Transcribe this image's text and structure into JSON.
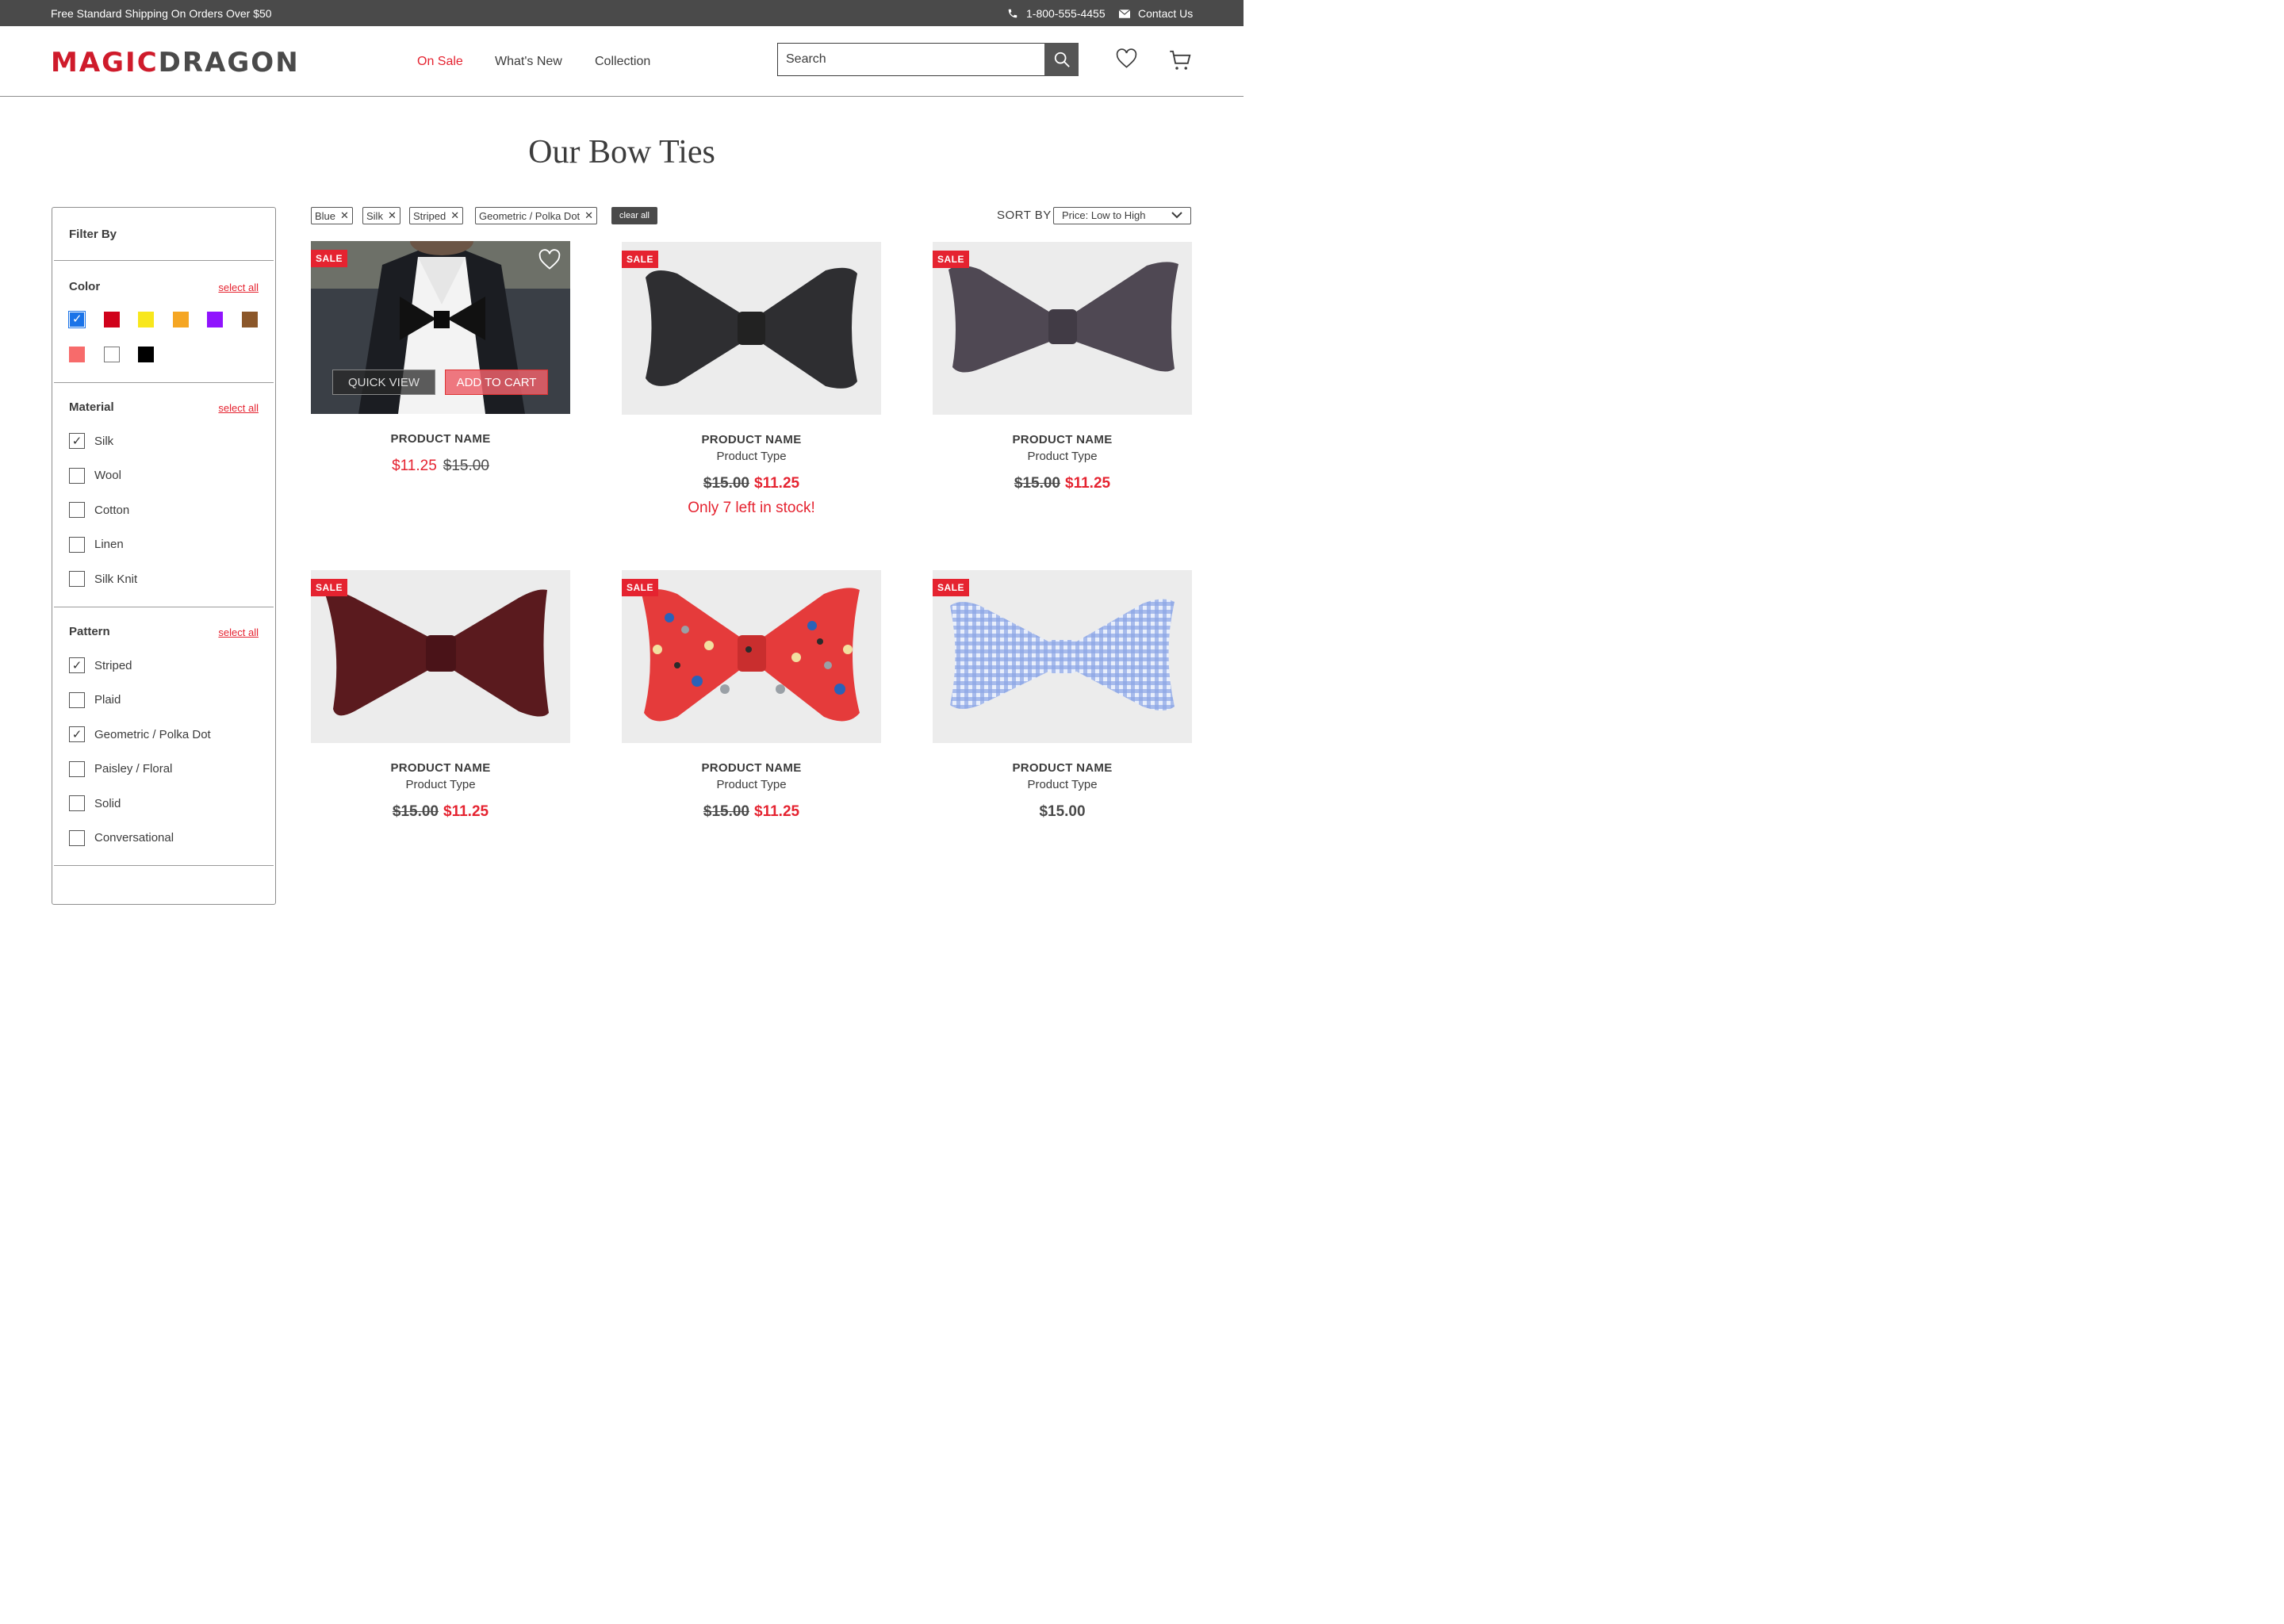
{
  "topbar": {
    "promo": "Free Standard Shipping On Orders Over $50",
    "phone": "1-800-555-4455",
    "contact": "Contact Us"
  },
  "header": {
    "logo_part1": "MAGIC",
    "logo_part2": "DRAGON",
    "nav": [
      "On Sale",
      "What's New",
      "Collection"
    ],
    "search_placeholder": "Search"
  },
  "page": {
    "title": "Our Bow Ties"
  },
  "filters": {
    "title": "Filter By",
    "select_all": "select all",
    "color": {
      "heading": "Color",
      "swatches": [
        {
          "hex": "#1a73e8",
          "checked": true
        },
        {
          "hex": "#d0021b",
          "checked": false
        },
        {
          "hex": "#f8e71c",
          "checked": false
        },
        {
          "hex": "#f5a623",
          "checked": false
        },
        {
          "hex": "#9013fe",
          "checked": false
        },
        {
          "hex": "#8b572a",
          "checked": false
        },
        {
          "hex": "#f76b6b",
          "checked": false
        },
        {
          "hex": "#ffffff",
          "checked": false
        },
        {
          "hex": "#000000",
          "checked": false
        }
      ]
    },
    "material": {
      "heading": "Material",
      "options": [
        {
          "label": "Silk",
          "checked": true
        },
        {
          "label": "Wool",
          "checked": false
        },
        {
          "label": "Cotton",
          "checked": false
        },
        {
          "label": "Linen",
          "checked": false
        },
        {
          "label": "Silk Knit",
          "checked": false
        }
      ]
    },
    "pattern": {
      "heading": "Pattern",
      "options": [
        {
          "label": "Striped",
          "checked": true
        },
        {
          "label": "Plaid",
          "checked": false
        },
        {
          "label": "Geometric / Polka Dot",
          "checked": true
        },
        {
          "label": "Paisley / Floral",
          "checked": false
        },
        {
          "label": "Solid",
          "checked": false
        },
        {
          "label": "Conversational",
          "checked": false
        }
      ]
    }
  },
  "chips": [
    "Blue",
    "Silk",
    "Striped",
    "Geometric / Polka Dot"
  ],
  "clear_all": "clear all",
  "sort": {
    "label": "SORT BY",
    "value": "Price: Low to High"
  },
  "products": [
    {
      "sale": "SALE",
      "name": "PRODUCT NAME",
      "type": "",
      "price_new": "$11.25",
      "price_old": "$15.00",
      "stock": "",
      "quick_view": "QUICK VIEW",
      "add_to_cart": "ADD TO CART"
    },
    {
      "sale": "SALE",
      "name": "PRODUCT NAME",
      "type": "Product Type",
      "price_old": "$15.00",
      "price_new": "$11.25",
      "stock": "Only 7 left in stock!"
    },
    {
      "sale": "SALE",
      "name": "PRODUCT NAME",
      "type": "Product Type",
      "price_old": "$15.00",
      "price_new": "$11.25",
      "stock": ""
    },
    {
      "sale": "SALE",
      "name": "PRODUCT NAME",
      "type": "Product Type",
      "price_old": "$15.00",
      "price_new": "$11.25",
      "stock": ""
    },
    {
      "sale": "SALE",
      "name": "PRODUCT NAME",
      "type": "Product Type",
      "price_old": "$15.00",
      "price_new": "$11.25",
      "stock": ""
    },
    {
      "sale": "SALE",
      "name": "PRODUCT NAME",
      "type": "Product Type",
      "price_regular": "$15.00",
      "stock": ""
    }
  ],
  "colors": {
    "accent": "#e52330",
    "dark": "#4a4a4a",
    "card_bg": "#ececec"
  }
}
